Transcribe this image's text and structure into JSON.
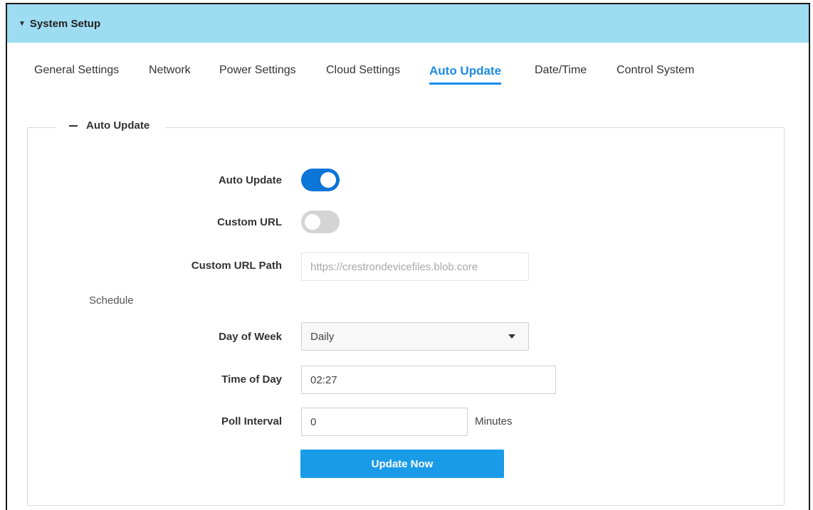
{
  "header": {
    "title": "System Setup",
    "caret_icon": "caret-down-icon"
  },
  "tabs": [
    {
      "label": "General Settings"
    },
    {
      "label": "Network"
    },
    {
      "label": "Power Settings"
    },
    {
      "label": "Cloud Settings"
    },
    {
      "label": "Auto Update",
      "active": true
    },
    {
      "label": "Date/Time"
    },
    {
      "label": "Control System"
    }
  ],
  "panel": {
    "legend": "Auto Update",
    "auto_update": {
      "label": "Auto Update",
      "enabled": true
    },
    "custom_url": {
      "label": "Custom URL",
      "enabled": false
    },
    "custom_url_path": {
      "label": "Custom URL Path",
      "value": "https://crestrondevicefiles.blob.core"
    },
    "schedule_label": "Schedule",
    "day_of_week": {
      "label": "Day of Week",
      "value": "Daily"
    },
    "time_of_day": {
      "label": "Time of Day",
      "value": "02:27"
    },
    "poll_interval": {
      "label": "Poll Interval",
      "value": "0",
      "unit": "Minutes"
    },
    "update_button": "Update Now"
  },
  "colors": {
    "header_bg": "#9edcf2",
    "accent": "#1b8ae6",
    "toggle_on": "#0b75d8",
    "toggle_off": "#d4d4d4",
    "button": "#1a9be8"
  }
}
